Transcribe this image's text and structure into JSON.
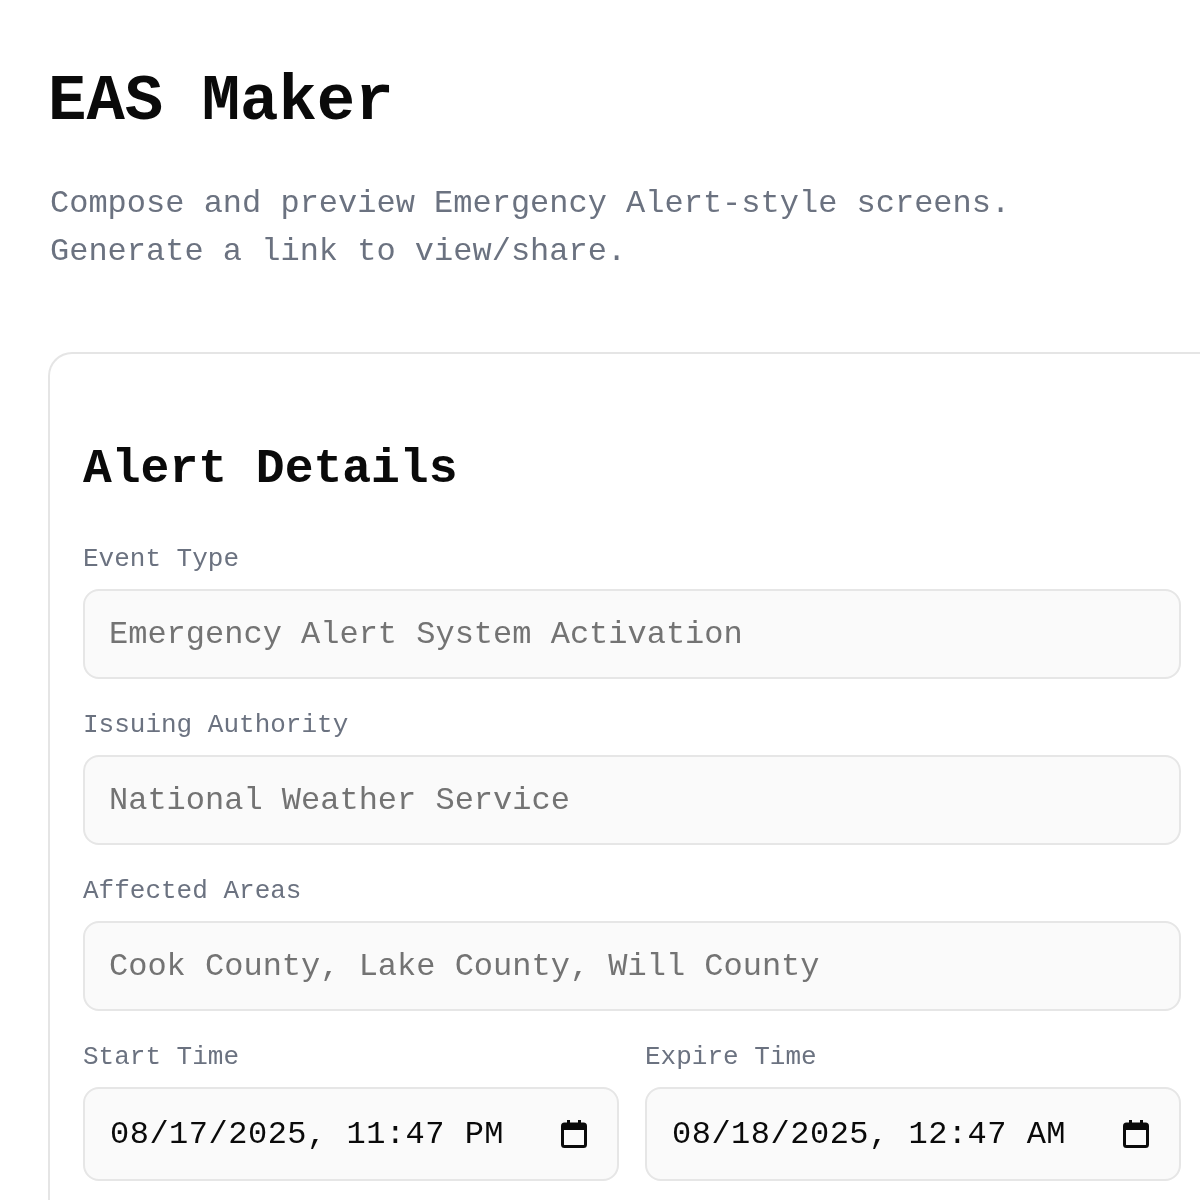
{
  "header": {
    "title": "EAS Maker",
    "subtitle": "Compose and preview Emergency Alert-style screens. Generate a link to view/share."
  },
  "card": {
    "title": "Alert Details",
    "fields": [
      {
        "label": "Event Type",
        "placeholder": "Emergency Alert System Activation"
      },
      {
        "label": "Issuing Authority",
        "placeholder": "National Weather Service"
      },
      {
        "label": "Affected Areas",
        "placeholder": "Cook County, Lake County, Will County"
      }
    ],
    "time_fields": [
      {
        "label": "Start Time",
        "value": "08/17/2025, 11:47 PM"
      },
      {
        "label": "Expire Time",
        "value": "08/18/2025, 12:47 AM"
      }
    ]
  }
}
